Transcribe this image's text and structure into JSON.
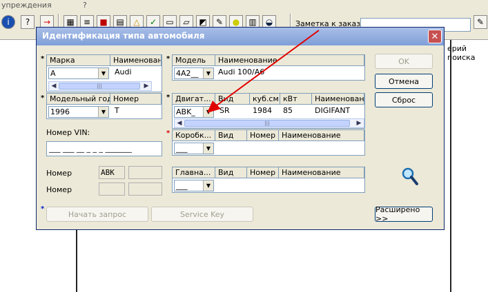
{
  "bg": {
    "menu_text": "упреждения",
    "menu_help": "?",
    "note_label": "Заметка к заказу:",
    "right_label": "ерий поиска",
    "toolbar_icons": [
      "info-icon",
      "help-icon",
      "arrow-icon",
      "calc-icon",
      "doc-icon",
      "book-icon",
      "grid-icon",
      "warn-icon",
      "check-icon",
      "car-icon",
      "cart-icon",
      "clip-icon",
      "pencil-icon",
      "bulb-icon",
      "stack-icon",
      "print-icon"
    ]
  },
  "dialog": {
    "title": "Идентификация типа автомобиля",
    "close_glyph": "✕",
    "marka": {
      "headers": [
        "Марка",
        "Наименовани"
      ],
      "combo_value": "A",
      "name_value": "Audi",
      "star": "*"
    },
    "model_year": {
      "headers": [
        "Модельный год",
        "Номер"
      ],
      "combo_value": "1996",
      "number_value": "T",
      "star": "*"
    },
    "vin": {
      "label": "Номер VIN:",
      "mask": "___  ___  __  _  _  _  _______"
    },
    "numbers": {
      "label1": "Номер",
      "label2": "Номер",
      "value1": "ABK"
    },
    "model": {
      "headers": [
        "Модель",
        "Наименование"
      ],
      "combo_value": "4A2__",
      "name_value": "Audi 100/A6",
      "star": "*"
    },
    "engine": {
      "headers": [
        "Двигат...",
        "Вид",
        "куб.см",
        "кВт",
        "Наименование"
      ],
      "combo_value": "ABK_",
      "values": [
        "SR",
        "1984",
        "85",
        "DIGIFANT"
      ],
      "star": "*"
    },
    "gearbox": {
      "headers": [
        "Коробк...",
        "Вид",
        "Номер",
        "Наименование"
      ],
      "combo_value": "___",
      "star": "*"
    },
    "main": {
      "headers": [
        "Главна...",
        "Вид",
        "Номер",
        "Наименование"
      ],
      "combo_value": "___"
    },
    "buttons": {
      "ok": "OK",
      "cancel": "Отмена",
      "reset": "Сброс",
      "start": "Начать запрос",
      "service_key": "Service Key",
      "extended": "Расширено >>"
    },
    "bottom_star": "*",
    "colors": {
      "title_bar": "#7f9fd8",
      "close": "#c75050",
      "arrow": "#e00000"
    }
  }
}
